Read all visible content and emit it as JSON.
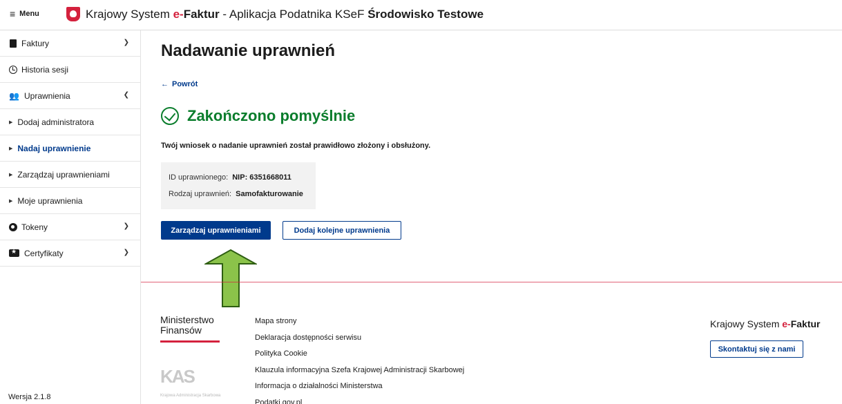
{
  "header": {
    "menu_label": "Menu",
    "title_prefix": "Krajowy System ",
    "title_brand_e": "e-",
    "title_brand": "Faktur",
    "title_suffix": " - Aplikacja Podatnika KSeF ",
    "title_env": "Środowisko Testowe"
  },
  "sidebar": {
    "items": [
      {
        "label": "Faktury",
        "icon": "document-icon",
        "chevron": "down"
      },
      {
        "label": "Historia sesji",
        "icon": "clock-icon"
      },
      {
        "label": "Uprawnienia",
        "icon": "users-icon",
        "chevron": "up"
      },
      {
        "label": "Dodaj administratora"
      },
      {
        "label": "Nadaj uprawnienie",
        "active": true
      },
      {
        "label": "Zarządzaj uprawnieniami"
      },
      {
        "label": "Moje uprawnienia"
      },
      {
        "label": "Tokeny",
        "icon": "token-icon",
        "chevron": "down"
      },
      {
        "label": "Certyfikaty",
        "icon": "certificate-icon",
        "chevron": "down"
      }
    ],
    "version": "Wersja 2.1.8"
  },
  "main": {
    "title": "Nadawanie uprawnień",
    "back_label": "Powrót",
    "success_title": "Zakończono pomyślnie",
    "message": "Twój wniosek o nadanie uprawnień został prawidłowo złożony i obsłużony.",
    "details": [
      {
        "label": "ID uprawnionego:",
        "value": "NIP: 6351668011"
      },
      {
        "label": "Rodzaj uprawnień:",
        "value": "Samofakturowanie"
      }
    ],
    "primary_button": "Zarządzaj uprawnieniami",
    "secondary_button": "Dodaj kolejne uprawnienia"
  },
  "footer": {
    "ministry_line1": "Ministerstwo",
    "ministry_line2": "Finansów",
    "kas_logo": "KAS",
    "kas_text": "Krajowa Administracja Skarbowa",
    "links": [
      "Mapa strony",
      "Deklaracja dostępności serwisu",
      "Polityka Cookie",
      "Klauzula informacyjna Szefa Krajowej Administracji Skarbowej",
      "Informacja o działalności Ministerstwa",
      "Podatki.gov.pl"
    ],
    "brand_prefix": "Krajowy System ",
    "brand_e": "e-",
    "brand_name": "Faktur",
    "contact_button": "Skontaktuj się z nami"
  },
  "colors": {
    "primary": "#003a8c",
    "success": "#0a7d2c",
    "brand_red": "#d4213d",
    "annotation_arrow": "#8bc34a"
  }
}
